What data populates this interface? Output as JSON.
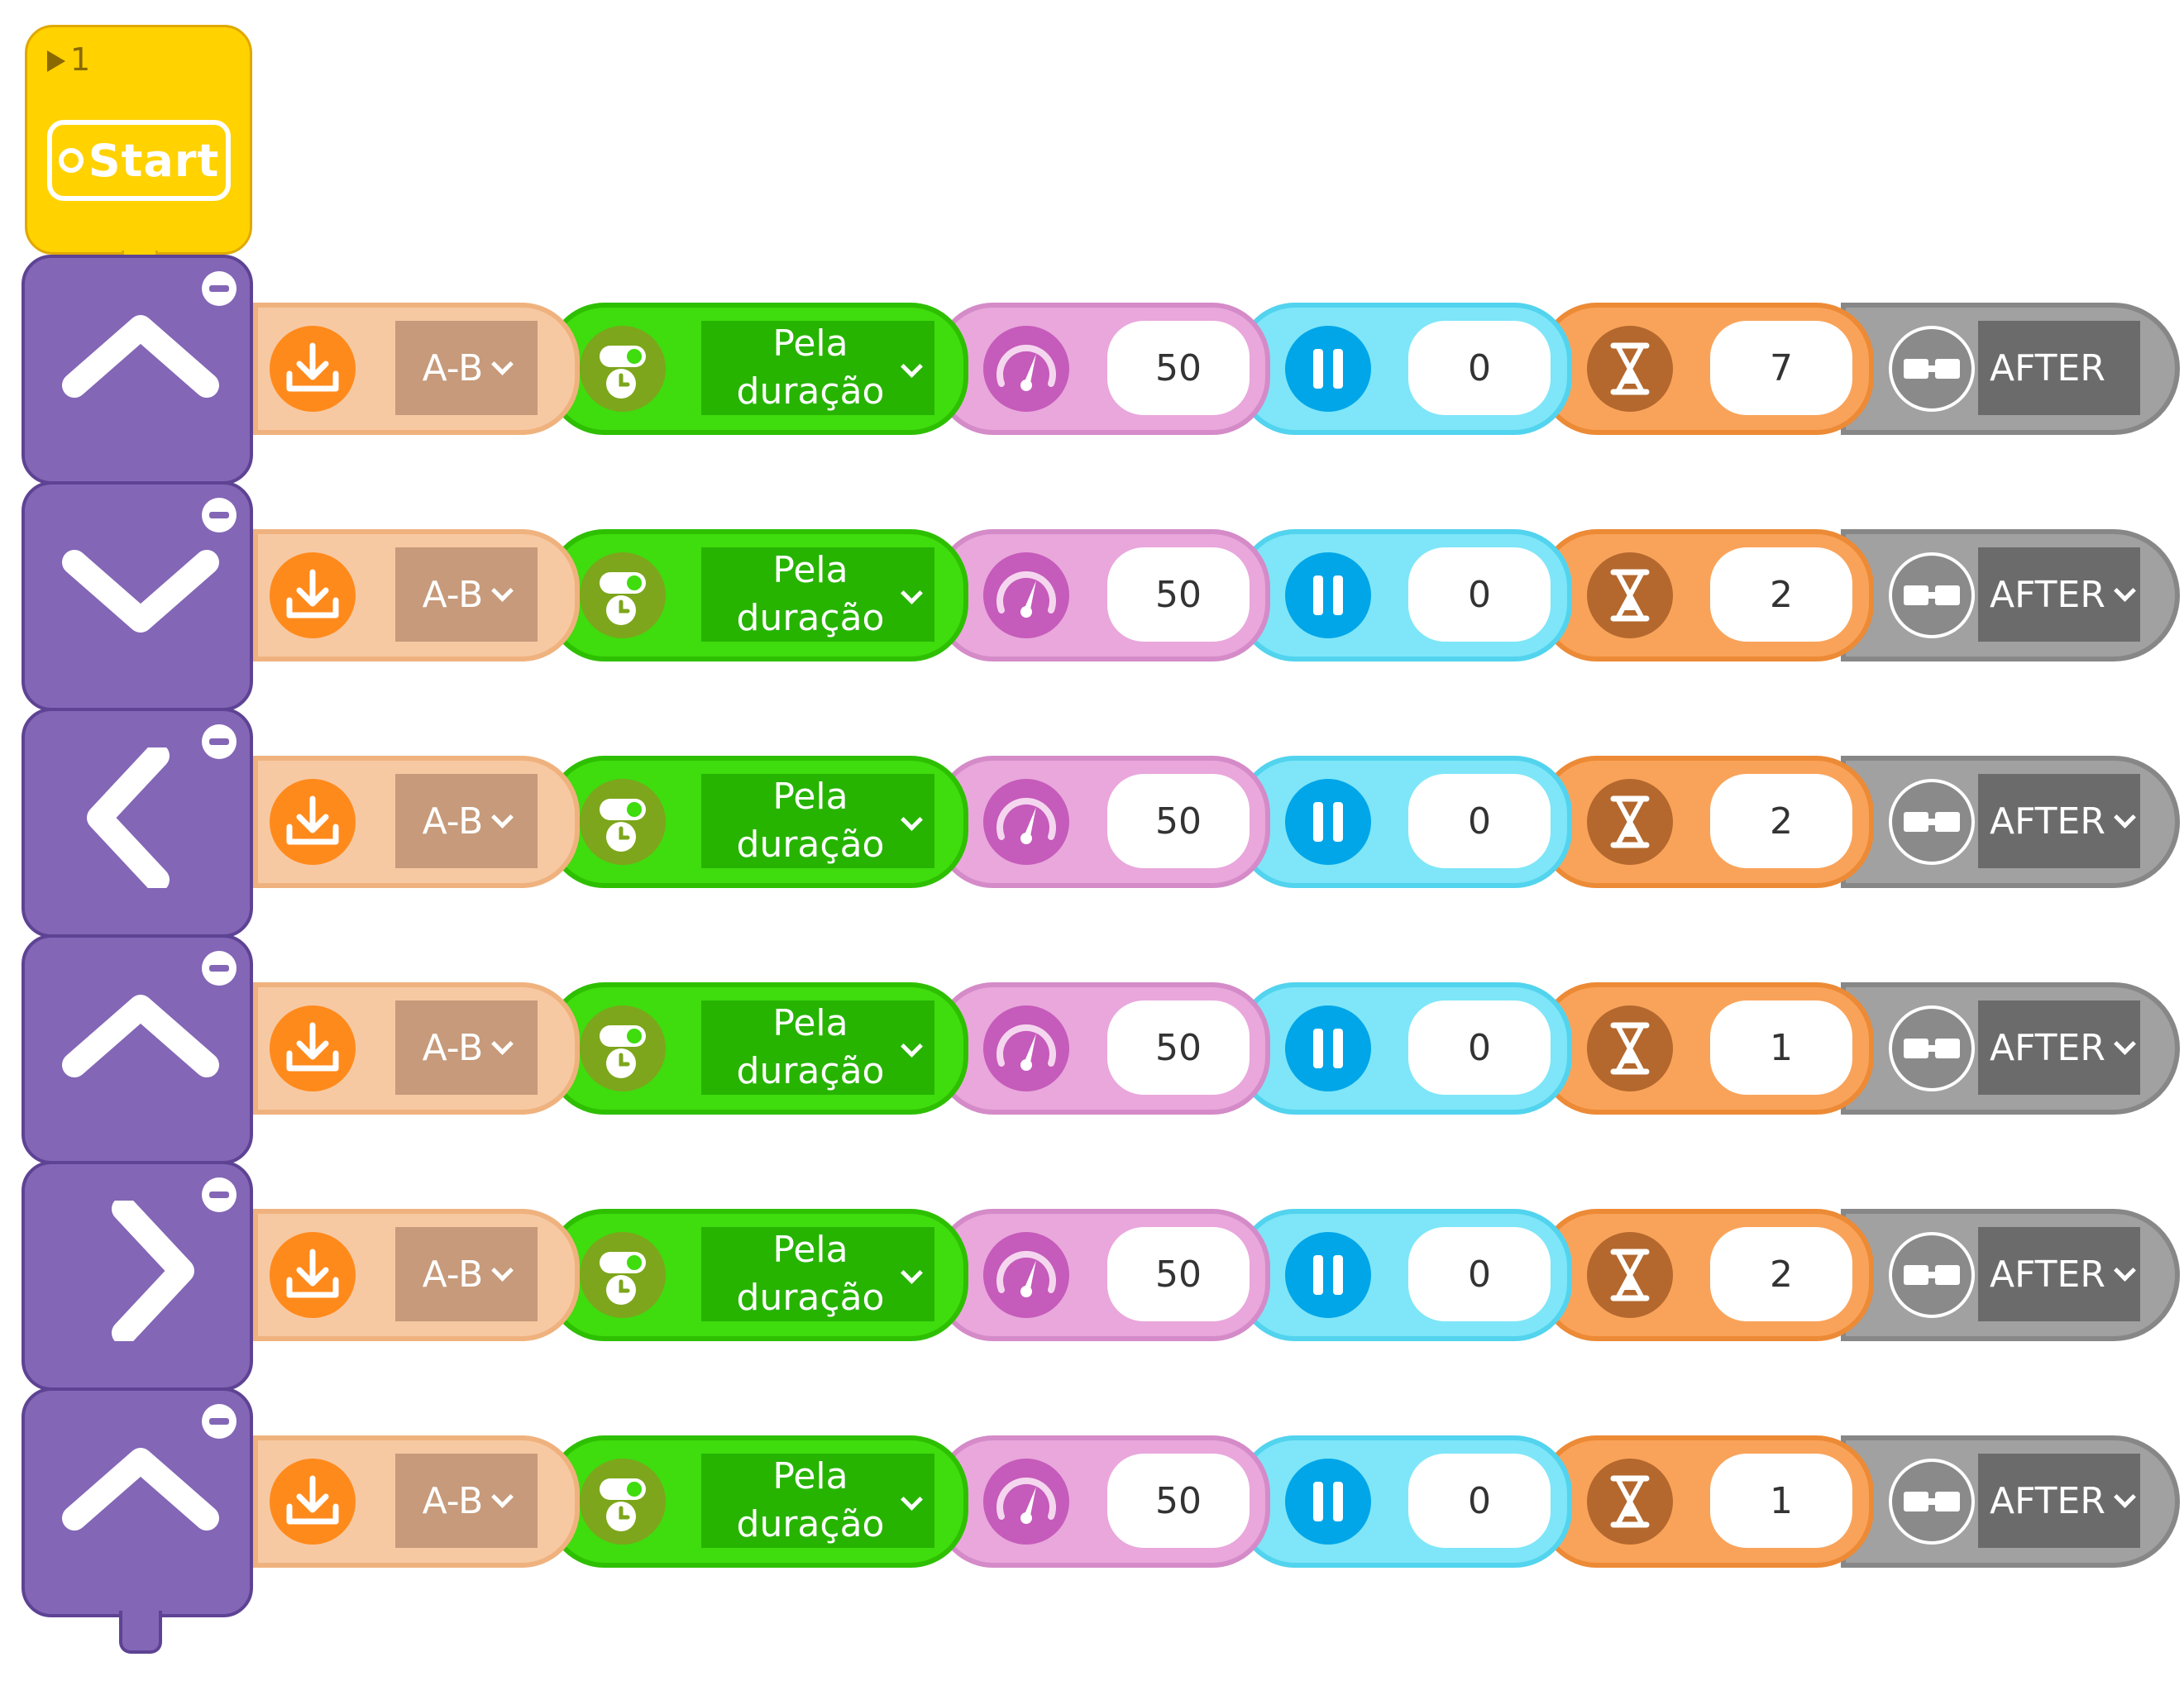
{
  "start_block": {
    "stack_number": "1",
    "label": "Start"
  },
  "rows": [
    {
      "direction": "up",
      "port": "A-B",
      "mode": [
        "Pela",
        "duração"
      ],
      "speed": "50",
      "wait": "0",
      "duration": "7",
      "after": "AFTER",
      "after_caret": false
    },
    {
      "direction": "down",
      "port": "A-B",
      "mode": [
        "Pela",
        "duração"
      ],
      "speed": "50",
      "wait": "0",
      "duration": "2",
      "after": "AFTER",
      "after_caret": true
    },
    {
      "direction": "left",
      "port": "A-B",
      "mode": [
        "Pela",
        "duração"
      ],
      "speed": "50",
      "wait": "0",
      "duration": "2",
      "after": "AFTER",
      "after_caret": true
    },
    {
      "direction": "up",
      "port": "A-B",
      "mode": [
        "Pela",
        "duração"
      ],
      "speed": "50",
      "wait": "0",
      "duration": "1",
      "after": "AFTER",
      "after_caret": true
    },
    {
      "direction": "right",
      "port": "A-B",
      "mode": [
        "Pela",
        "duração"
      ],
      "speed": "50",
      "wait": "0",
      "duration": "2",
      "after": "AFTER",
      "after_caret": true
    },
    {
      "direction": "up",
      "port": "A-B",
      "mode": [
        "Pela",
        "duração"
      ],
      "speed": "50",
      "wait": "0",
      "duration": "1",
      "after": "AFTER",
      "after_caret": true
    }
  ],
  "icons": {
    "port": "download-tray-icon",
    "mode": "toggle-clock-icon",
    "speed": "speedometer-icon",
    "wait": "pause-icon",
    "duration": "hourglass-icon",
    "after": "link-blocks-icon"
  },
  "colors": {
    "start": "#ffd200",
    "action": "#8366b6",
    "port": "#f7c9a3",
    "mode": "#3fdc0e",
    "speed": "#e9a7dc",
    "wait": "#7ee6f8",
    "duration": "#f9a35a",
    "after": "#a1a1a1"
  }
}
